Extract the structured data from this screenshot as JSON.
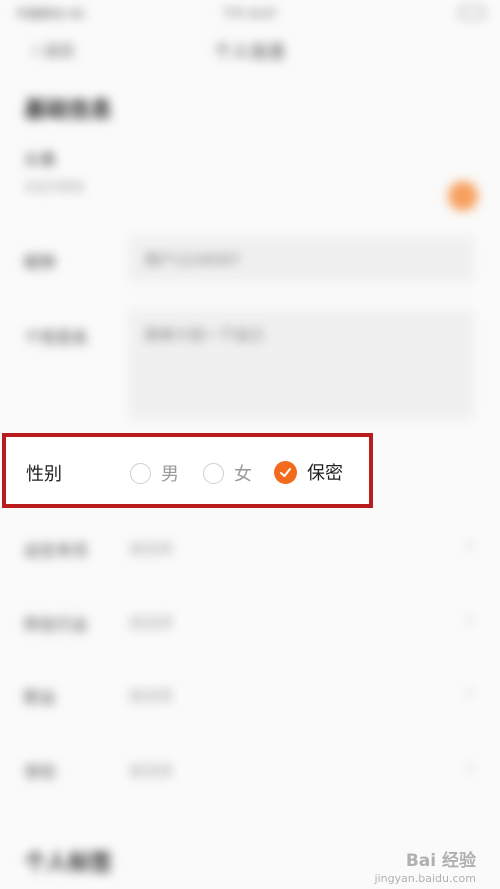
{
  "status_bar": {
    "carrier": "中国移动 4G",
    "time": "下午 8:07"
  },
  "nav": {
    "back_label": "〈 返回",
    "title": "个人信息"
  },
  "basic_section": {
    "title": "基础信息"
  },
  "avatar_row": {
    "label": "头像",
    "sublabel": "点击可修改"
  },
  "nickname_row": {
    "label": "昵称",
    "value": "用户1234567"
  },
  "bio_row": {
    "label": "个性签名",
    "placeholder": "简单介绍一下自己"
  },
  "gender_row": {
    "label": "性别",
    "options": [
      {
        "label": "男",
        "selected": false
      },
      {
        "label": "女",
        "selected": false
      },
      {
        "label": "保密",
        "selected": true
      }
    ],
    "accent_color": "#f26b1d",
    "highlight_color": "#b81c1c"
  },
  "rows": [
    {
      "label": "出生年月",
      "value": "请选择"
    },
    {
      "label": "所在行业",
      "value": "请选择"
    },
    {
      "label": "职业",
      "value": "请选择"
    },
    {
      "label": "学历",
      "value": "请选择"
    }
  ],
  "profile_section": {
    "title": "个人标签"
  },
  "watermark": {
    "text": "Bai 经验",
    "sub": "jingyan.baidu.com"
  }
}
